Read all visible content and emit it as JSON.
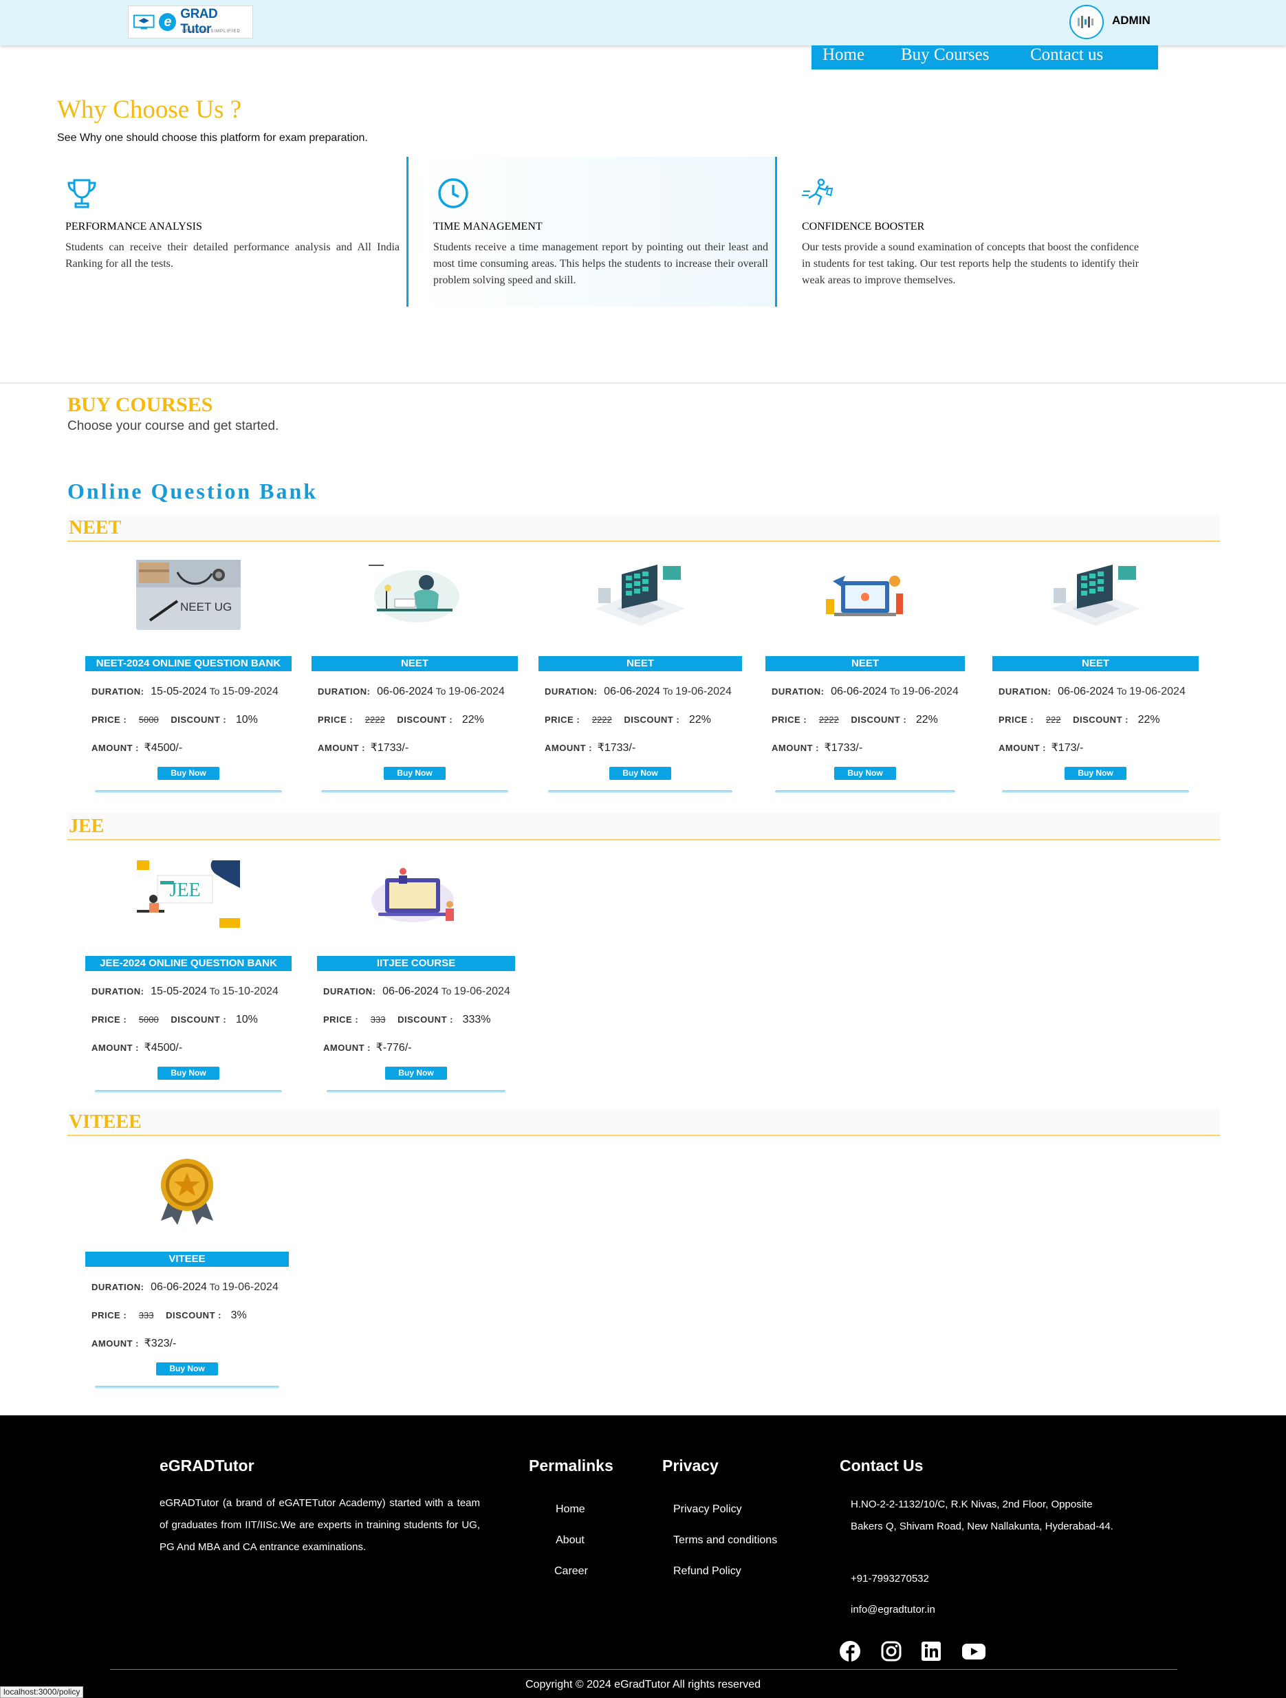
{
  "header": {
    "logo_text": "GRAD Tutor",
    "logo_letter": "e",
    "logo_tagline": "LEARNING SIMPLIFIED",
    "admin_label": "ADMIN",
    "nav": [
      {
        "label": "Home"
      },
      {
        "label": "Buy Courses"
      },
      {
        "label": "Contact us"
      }
    ]
  },
  "why": {
    "title": "Why Choose Us ?",
    "subtitle": "See Why one should choose this platform for exam preparation.",
    "features": [
      {
        "icon": "trophy-icon",
        "title": "PERFORMANCE ANALYSIS",
        "text": "Students can receive their detailed performance analysis and All India Ranking for all the tests."
      },
      {
        "icon": "clock-icon",
        "title": "TIME MANAGEMENT",
        "text": "Students receive a time management report by pointing out their least and most time consuming areas. This helps the students to increase their overall problem solving speed and skill."
      },
      {
        "icon": "running-person-icon",
        "title": "CONFIDENCE BOOSTER",
        "text": "Our tests provide a sound examination of concepts that boost the confidence in students for test taking. Our test reports help the students to identify their weak areas to improve themselves."
      }
    ]
  },
  "buy": {
    "title": "BUY COURSES",
    "subtitle": "Choose your course and get started.",
    "section_title": "Online Question Bank",
    "labels": {
      "duration": "DURATION:",
      "to": "To",
      "price": "PRICE :",
      "discount": "DISCOUNT :",
      "amount": "AMOUNT :",
      "buy_now": "Buy Now"
    },
    "categories": [
      {
        "name": "NEET",
        "courses": [
          {
            "name": "NEET-2024 ONLINE QUESTION BANK",
            "from": "15-05-2024",
            "to": "15-09-2024",
            "price": "5000",
            "discount": "10%",
            "amount": "₹4500/-",
            "image": "neet-ug-stethoscope-image",
            "image_text": "NEET UG"
          },
          {
            "name": "NEET",
            "from": "06-06-2024",
            "to": "19-06-2024",
            "price": "2222",
            "discount": "22%",
            "amount": "₹1733/-",
            "image": "student-studying-image"
          },
          {
            "name": "NEET",
            "from": "06-06-2024",
            "to": "19-06-2024",
            "price": "2222",
            "discount": "22%",
            "amount": "₹1733/-",
            "image": "isometric-laptop-image"
          },
          {
            "name": "NEET",
            "from": "06-06-2024",
            "to": "19-06-2024",
            "price": "2222",
            "discount": "22%",
            "amount": "₹1733/-",
            "image": "online-learning-laptop-image"
          },
          {
            "name": "NEET",
            "from": "06-06-2024",
            "to": "19-06-2024",
            "price": "222",
            "discount": "22%",
            "amount": "₹173/-",
            "image": "isometric-laptop-image"
          }
        ]
      },
      {
        "name": "JEE",
        "courses": [
          {
            "name": "JEE-2024 ONLINE QUESTION BANK",
            "from": "15-05-2024",
            "to": "15-10-2024",
            "price": "5000",
            "discount": "10%",
            "amount": "₹4500/-",
            "image": "jee-classroom-image",
            "image_text": "JEE"
          },
          {
            "name": "IITJEE COURSE",
            "from": "06-06-2024",
            "to": "19-06-2024",
            "price": "333",
            "discount": "333%",
            "amount": "₹-776/-",
            "image": "laptop-student-image"
          }
        ]
      },
      {
        "name": "VITEEE",
        "courses": [
          {
            "name": "VITEEE",
            "from": "06-06-2024",
            "to": "19-06-2024",
            "price": "333",
            "discount": "3%",
            "amount": "₹323/-",
            "image": "award-badge-image"
          }
        ]
      }
    ]
  },
  "footer": {
    "brand": "eGRADTutor",
    "about": "eGRADTutor (a brand of eGATETutor Academy) started with a team of graduates from IIT/IISc.We are experts in training students for UG, PG And MBA and CA entrance examinations.",
    "permalinks_title": "Permalinks",
    "permalinks": [
      "Home",
      "About",
      "Career"
    ],
    "privacy_title": "Privacy",
    "privacy_links": [
      "Privacy Policy",
      "Terms and conditions",
      "Refund Policy"
    ],
    "contact_title": "Contact Us",
    "address": "H.NO-2-2-1132/10/C, R.K Nivas, 2nd Floor, Opposite Bakers Q, Shivam Road, New Nallakunta, Hyderabad-44.",
    "phone": "+91-7993270532",
    "email": "info@egradtutor.in",
    "social": [
      "facebook-icon",
      "instagram-icon",
      "linkedin-icon",
      "youtube-icon"
    ],
    "copyright": "Copyright © 2024 eGradTutor All rights reserved"
  },
  "status_bar_url": "localhost:3000/policy",
  "colors": {
    "accent": "#0aa3e4",
    "heading": "#f6b90f",
    "footer_bg": "#000000"
  }
}
